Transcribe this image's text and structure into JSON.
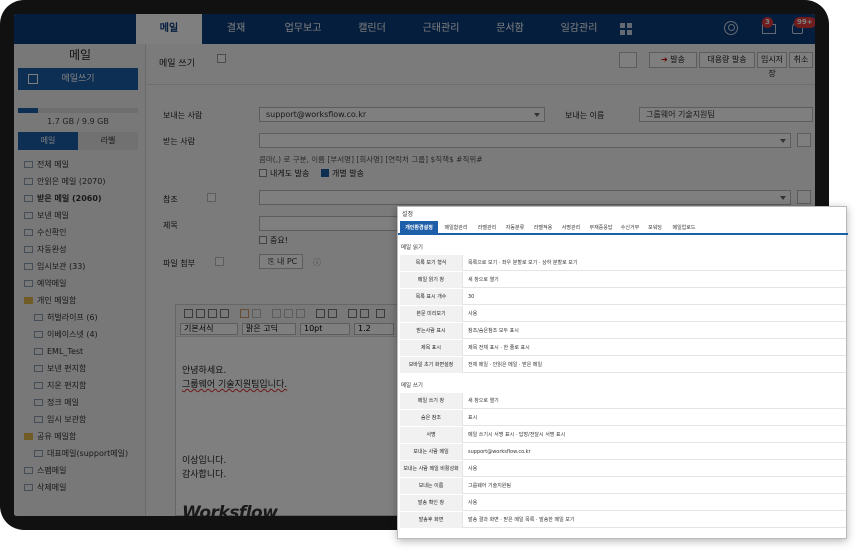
{
  "nav": {
    "items": [
      "메일",
      "결재",
      "업무보고",
      "캘린더",
      "근태관리",
      "문서함",
      "일감관리"
    ],
    "active": "메일",
    "badge_mail": "3",
    "badge_bell": "99+"
  },
  "sidebar": {
    "title": "메일",
    "compose": "메일쓰기",
    "quota": "1.7 GB / 9.9 GB",
    "quota_fraction": 0.17,
    "tabs": [
      "메일",
      "라벨"
    ],
    "folders": [
      {
        "label": "전체 메일",
        "bold": false,
        "type": "mail",
        "indent": 0
      },
      {
        "label": "안읽은 메일 (2070)",
        "bold": false,
        "type": "mail",
        "indent": 0
      },
      {
        "label": "받은 메일 (2060)",
        "bold": true,
        "type": "mail",
        "indent": 0
      },
      {
        "label": "보낸 메일",
        "bold": false,
        "type": "mail",
        "indent": 0
      },
      {
        "label": "수신확인",
        "bold": false,
        "type": "mail",
        "indent": 0
      },
      {
        "label": "자동완성",
        "bold": false,
        "type": "mail",
        "indent": 0
      },
      {
        "label": "임시보관 (33)",
        "bold": false,
        "type": "mail",
        "indent": 0
      },
      {
        "label": "예약메일",
        "bold": false,
        "type": "mail",
        "indent": 0
      },
      {
        "label": "개인 메일함",
        "bold": false,
        "type": "folder",
        "indent": 0
      },
      {
        "label": "허벌라이프 (6)",
        "bold": false,
        "type": "mail",
        "indent": 1
      },
      {
        "label": "이베이스넷 (4)",
        "bold": false,
        "type": "mail",
        "indent": 1
      },
      {
        "label": "EML_Test",
        "bold": false,
        "type": "mail",
        "indent": 1
      },
      {
        "label": "보낸 편지함",
        "bold": false,
        "type": "mail",
        "indent": 1
      },
      {
        "label": "지운 편지함",
        "bold": false,
        "type": "mail",
        "indent": 1
      },
      {
        "label": "정크 메일",
        "bold": false,
        "type": "mail",
        "indent": 1
      },
      {
        "label": "임시 보관함",
        "bold": false,
        "type": "mail",
        "indent": 1
      },
      {
        "label": "공유 메일함",
        "bold": false,
        "type": "folder",
        "indent": 0
      },
      {
        "label": "대표메일(support메일)",
        "bold": false,
        "type": "mail",
        "indent": 1
      },
      {
        "label": "스팸메일",
        "bold": false,
        "type": "mail",
        "indent": 0
      },
      {
        "label": "삭제메일",
        "bold": false,
        "type": "mail",
        "indent": 0
      }
    ]
  },
  "compose": {
    "title": "메일 쓰기",
    "buttons": [
      "발송",
      "대용량 발송",
      "임시저장",
      "취소"
    ],
    "sender_label": "보내는 사람",
    "sender_value": "support@worksflow.co.kr",
    "sender_name_label": "보내는 이름",
    "sender_name_value": "그룹웨어 기술지원팀",
    "to_label": "받는 사람",
    "to_hint": "콤마(,) 로 구분, 이름 [부서명] [회사명] [연락처 그룹] $직책$ #직위#",
    "cb_self": "내게도 발송",
    "cb_individual": "개별 발송",
    "cc_label": "참조",
    "subject_label": "제목",
    "important": "중요!",
    "attach_label": "파일 첨부",
    "attach_pc": "내 PC"
  },
  "editor": {
    "format": "기본서식",
    "font": "맑은 고딕",
    "size": "10pt",
    "line": "1.2",
    "body1": "안녕하세요.",
    "body2": "그룹웨어 기술지원팀입니다.",
    "body3": "이상입니다.",
    "body4": "감사합니다.",
    "logo": "Worksflow"
  },
  "settings": {
    "title": "설정",
    "tabs": [
      "개인환경설정",
      "메일함관리",
      "라벨관리",
      "자동분류",
      "라벨적용",
      "서명관리",
      "부재중응답",
      "수신거부",
      "포워딩",
      "메일업로드"
    ],
    "read_section": "메일 읽기",
    "read_rows": [
      {
        "label": "목록 보기 형식",
        "value": "목록으로 보기 · 좌우 분할로 보기 · 상하 분할로 보기"
      },
      {
        "label": "메일 읽기 창",
        "value": "새 창으로 열기"
      },
      {
        "label": "목록 표시 개수",
        "value": "30"
      },
      {
        "label": "본문 미리보기",
        "value": "사용"
      },
      {
        "label": "받는사람 표시",
        "value": "참조/숨은참조 모두 표시"
      },
      {
        "label": "제목 표시",
        "value": "제목 전체 표시 · 한 줄로 표시"
      },
      {
        "label": "모바일 초기 화면설정",
        "value": "전체 메일 · 안읽은 메일 · 받은 메일"
      }
    ],
    "write_section": "메일 쓰기",
    "write_rows": [
      {
        "label": "메일 쓰기 창",
        "value": "새 창으로 열기"
      },
      {
        "label": "숨은 참조",
        "value": "표시"
      },
      {
        "label": "서명",
        "value": "메일 쓰기시 서명 표시 · 답장/전달시 서명 표시"
      },
      {
        "label": "보내는 사람 메일",
        "value": "support@worksflow.co.kr"
      },
      {
        "label": "보내는 사람 메일 비활성화",
        "value": "사용"
      },
      {
        "label": "보내는 이름",
        "value": "그룹웨어 기술지원팀"
      },
      {
        "label": "발송 확인 창",
        "value": "사용"
      },
      {
        "label": "발송후 화면",
        "value": "발송 결과 화면 · 받은 메일 목록 · 발송한 메일 보기"
      }
    ]
  }
}
